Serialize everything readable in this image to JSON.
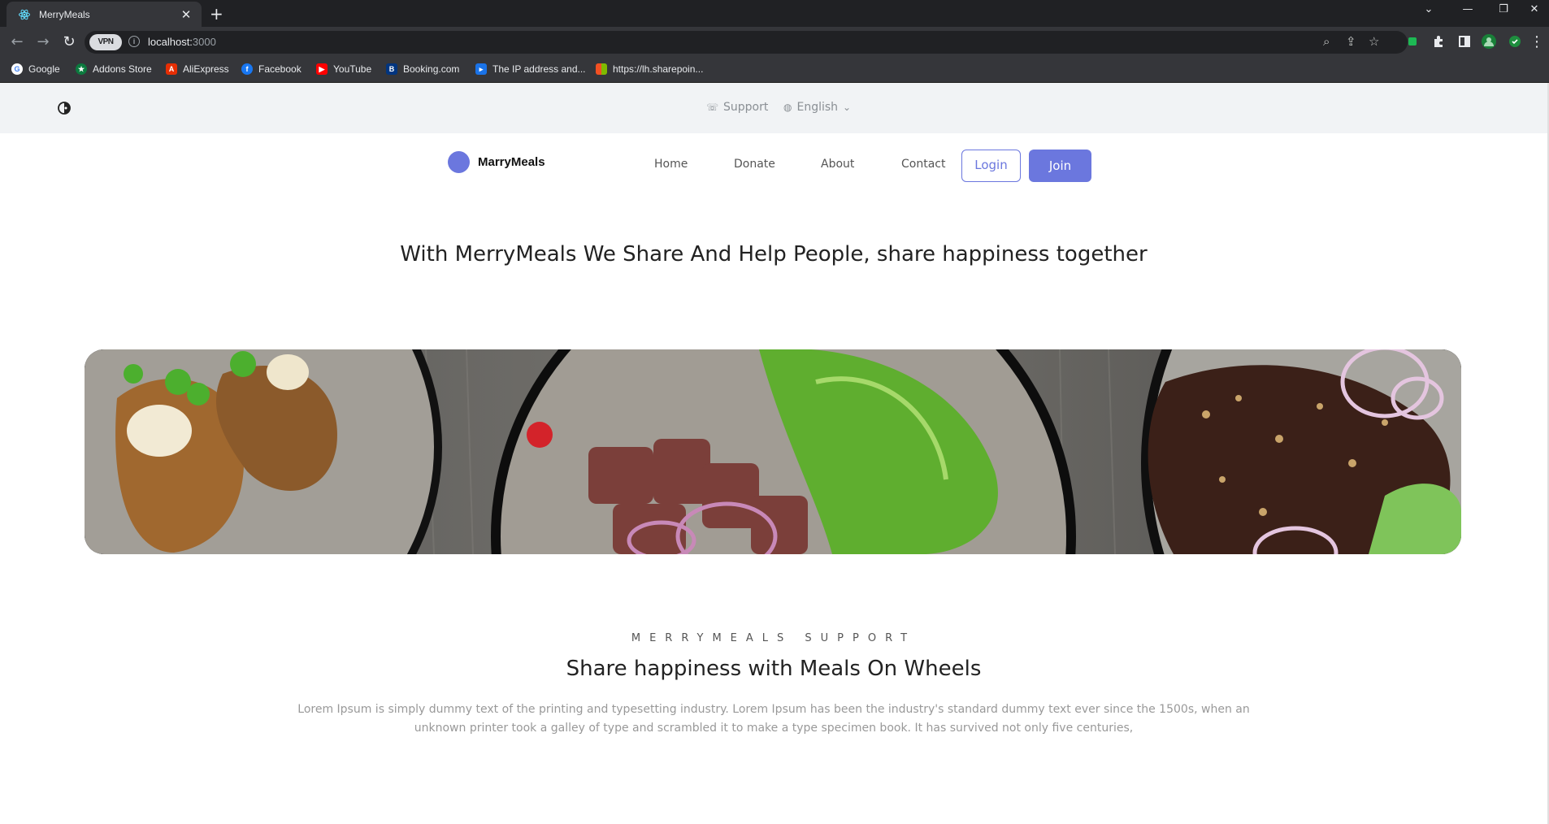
{
  "browser": {
    "tab_title": "MerryMeals",
    "url_host": "localhost:",
    "url_port": "3000",
    "vpn_label": "VPN",
    "bookmarks": [
      {
        "label": "Google"
      },
      {
        "label": "Addons Store"
      },
      {
        "label": "AliExpress"
      },
      {
        "label": "Facebook"
      },
      {
        "label": "YouTube"
      },
      {
        "label": "Booking.com"
      },
      {
        "label": "The IP address and..."
      },
      {
        "label": "https://lh.sharepoin..."
      }
    ]
  },
  "topbar": {
    "support": "Support",
    "language": "English"
  },
  "navbar": {
    "brand": "MarryMeals",
    "links": [
      "Home",
      "Donate",
      "About",
      "Contact"
    ],
    "login": "Login",
    "join": "Join"
  },
  "hero": {
    "title": "With MerryMeals We Share And Help People, share happiness together"
  },
  "section": {
    "eyebrow": "MERRYMEALS SUPPORT",
    "title": "Share happiness with Meals On Wheels",
    "body": "Lorem Ipsum is simply dummy text of the printing and typesetting industry. Lorem Ipsum has been the industry's standard dummy text ever since the 1500s, when an unknown printer took a galley of type and scrambled it to make a type specimen book. It has survived not only five centuries,"
  },
  "colors": {
    "accent": "#6b77de",
    "topbar_bg": "#f1f3f5",
    "chrome_dark": "#202124"
  }
}
